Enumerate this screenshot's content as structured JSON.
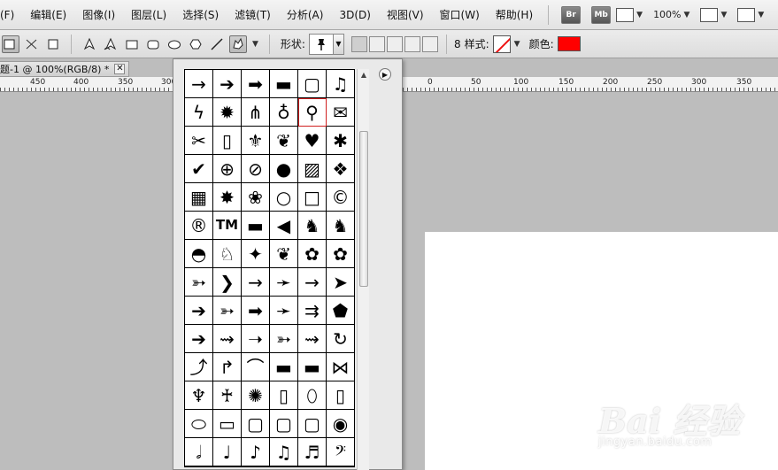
{
  "menu": {
    "items": [
      "(F)",
      "编辑(E)",
      "图像(I)",
      "图层(L)",
      "选择(S)",
      "滤镜(T)",
      "分析(A)",
      "3D(D)",
      "视图(V)",
      "窗口(W)",
      "帮助(H)"
    ],
    "bridge": "Br",
    "minibridge": "Mb",
    "zoom": "100%"
  },
  "options": {
    "shape_label": "形状:",
    "style_label": "样式:",
    "color_label": "颜色:",
    "color_value": "#ff0000"
  },
  "document": {
    "tab_title": "题-1 @ 100%(RGB/8) *",
    "close": "✕"
  },
  "ruler": {
    "labels": [
      "450",
      "400",
      "350",
      "300",
      "0",
      "50",
      "100",
      "150",
      "200",
      "250",
      "300",
      "350"
    ]
  },
  "shapes": [
    "arrow-thin",
    "arrow-bold",
    "arrow-block",
    "banner",
    "frame-square",
    "music-notes",
    "lightning",
    "starburst",
    "grass",
    "lightbulb",
    "pushpin",
    "envelope",
    "scissors",
    "blank-page",
    "fleur-de-lis",
    "ornament",
    "heart",
    "splat",
    "checkmark",
    "target",
    "no-sign",
    "speech-bubble",
    "hatch-square",
    "diamond-grid",
    "grid",
    "burst",
    "paw",
    "circle",
    "square",
    "copyright",
    "registered",
    "trademark",
    "bone",
    "fish",
    "cat",
    "dog",
    "snail",
    "rabbit",
    "bird",
    "dove",
    "paw-print",
    "paw-print-2",
    "arrow-feather",
    "chevron",
    "arrow-line",
    "arrow-dart",
    "arrow-plain",
    "arrow-triangle",
    "arrow-thick",
    "arrow-feather-2",
    "arrow-block-2",
    "arrow-dart-2",
    "arrow-double",
    "arrow-pentagon",
    "arrow-bold-2",
    "arrow-wave",
    "arrow-thin-2",
    "arrow-feather-3",
    "arrow-squiggle",
    "arrow-uturn",
    "arrow-curve",
    "arrow-corner",
    "bracket-banner",
    "banner-rounded",
    "banner-curved",
    "banner-bow",
    "award-ribbon",
    "awareness-ribbon",
    "seal",
    "frame-ornate",
    "frame-oval",
    "frame-rect",
    "frame-oval-2",
    "frame-tab",
    "frame-stamp",
    "frame-square-2",
    "frame-scallop",
    "eye",
    "half-note",
    "quarter-note",
    "eighth-note",
    "beamed-notes",
    "sixteenth-note",
    "bass-clef"
  ],
  "shape_glyphs": {
    "arrow-thin": "→",
    "arrow-bold": "➔",
    "arrow-block": "➡",
    "banner": "▬",
    "frame-square": "▢",
    "music-notes": "♫",
    "lightning": "ϟ",
    "starburst": "✹",
    "grass": "⋔",
    "lightbulb": "♁",
    "pushpin": "⚲",
    "envelope": "✉",
    "scissors": "✂",
    "blank-page": "▯",
    "fleur-de-lis": "⚜",
    "ornament": "❦",
    "heart": "♥",
    "splat": "✱",
    "checkmark": "✔",
    "target": "⊕",
    "no-sign": "⊘",
    "speech-bubble": "●",
    "hatch-square": "▨",
    "diamond-grid": "❖",
    "grid": "▦",
    "burst": "✸",
    "paw": "❀",
    "circle": "○",
    "square": "□",
    "copyright": "©",
    "registered": "®",
    "trademark": "TM",
    "bone": "▬",
    "fish": "◀",
    "cat": "♞",
    "dog": "♞",
    "snail": "◓",
    "rabbit": "♘",
    "bird": "✦",
    "dove": "❦",
    "paw-print": "✿",
    "paw-print-2": "✿",
    "arrow-feather": "➳",
    "chevron": "❯",
    "arrow-line": "→",
    "arrow-dart": "➛",
    "arrow-plain": "→",
    "arrow-triangle": "➤",
    "arrow-thick": "➔",
    "arrow-feather-2": "➳",
    "arrow-block-2": "➡",
    "arrow-dart-2": "➛",
    "arrow-double": "⇉",
    "arrow-pentagon": "⬟",
    "arrow-bold-2": "➔",
    "arrow-wave": "⇝",
    "arrow-thin-2": "➝",
    "arrow-feather-3": "➳",
    "arrow-squiggle": "⇝",
    "arrow-uturn": "↻",
    "arrow-curve": "⤴",
    "arrow-corner": "↱",
    "bracket-banner": "⌒",
    "banner-rounded": "▬",
    "banner-curved": "▬",
    "banner-bow": "⋈",
    "award-ribbon": "♆",
    "awareness-ribbon": "♰",
    "seal": "✺",
    "frame-ornate": "▯",
    "frame-oval": "⬯",
    "frame-rect": "▯",
    "frame-oval-2": "⬭",
    "frame-tab": "▭",
    "frame-stamp": "▢",
    "frame-square-2": "▢",
    "frame-scallop": "▢",
    "eye": "◉",
    "half-note": "𝅗𝅥",
    "quarter-note": "♩",
    "eighth-note": "♪",
    "beamed-notes": "♫",
    "sixteenth-note": "♬",
    "bass-clef": "𝄢"
  },
  "selected_shape": "pushpin",
  "watermark": {
    "brand": "Bai 经验",
    "url": "jingyan.baidu.com"
  }
}
